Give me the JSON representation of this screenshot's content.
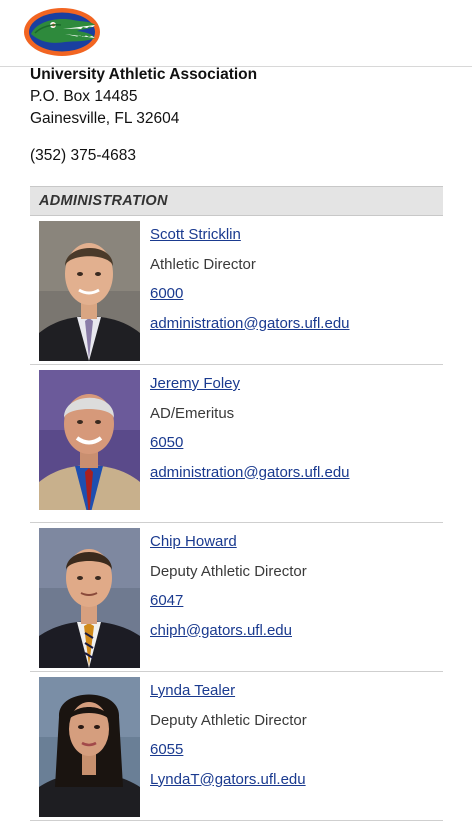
{
  "header": {
    "logo_icon": "gator-logo",
    "brand_colors": {
      "orange": "#f26522",
      "blue": "#1a3fa0",
      "green": "#2e8a3c"
    }
  },
  "contact": {
    "org": "University Athletic Association",
    "address1": "P.O. Box 14485",
    "address2": "Gainesville, FL 32604",
    "phone": "(352) 375-4683"
  },
  "section": {
    "title": "ADMINISTRATION",
    "staff": [
      {
        "name": "Scott Stricklin",
        "title": "Athletic Director",
        "ext": "6000",
        "email": "administration@gators.ufl.edu"
      },
      {
        "name": "Jeremy Foley",
        "title": "AD/Emeritus",
        "ext": "6050",
        "email": "administration@gators.ufl.edu"
      },
      {
        "name": "Chip Howard",
        "title": "Deputy Athletic Director",
        "ext": "6047",
        "email": "chiph@gators.ufl.edu"
      },
      {
        "name": "Lynda Tealer",
        "title": "Deputy Athletic Director",
        "ext": "6055",
        "email": "LyndaT@gators.ufl.edu"
      }
    ]
  }
}
